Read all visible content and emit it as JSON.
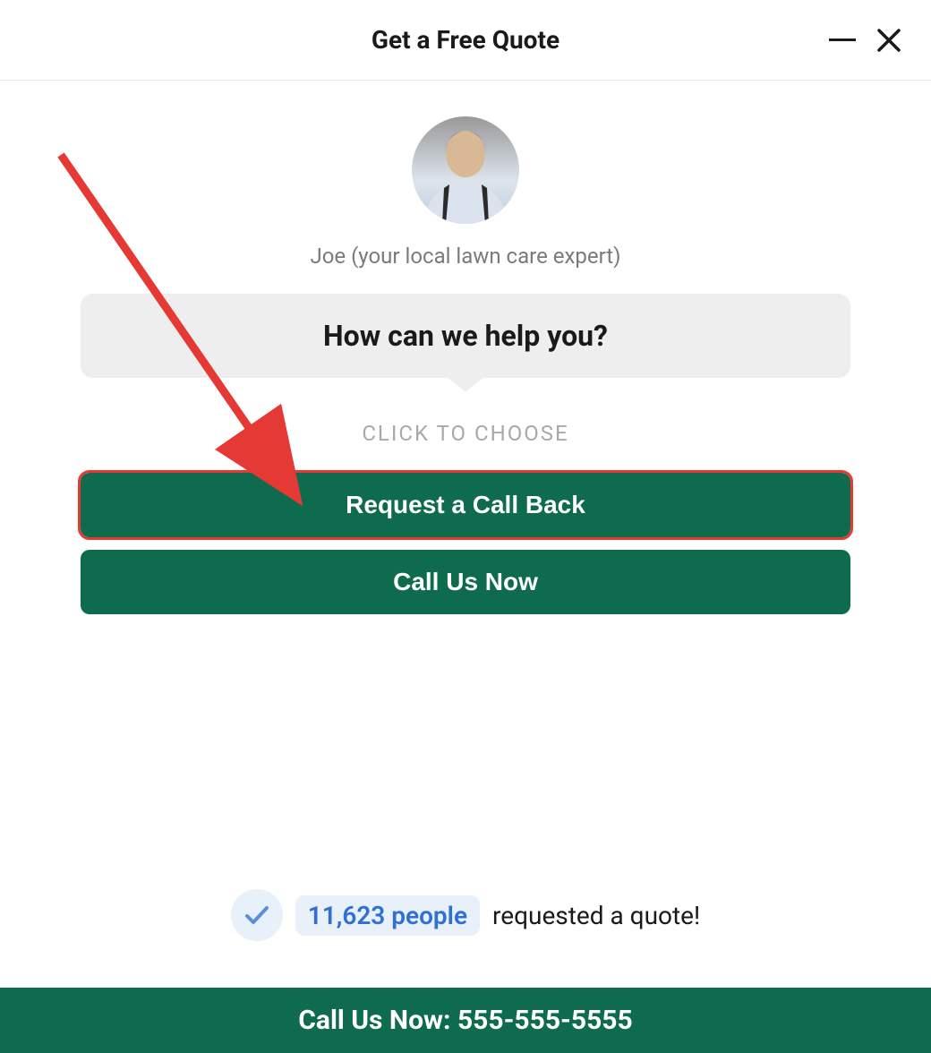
{
  "header": {
    "title": "Get a Free Quote"
  },
  "expert": {
    "label": "Joe (your local lawn care expert)"
  },
  "question": {
    "text": "How can we help you?"
  },
  "choose": {
    "label": "CLICK TO CHOOSE"
  },
  "options": {
    "request_callback": "Request a Call Back",
    "call_now": "Call Us Now"
  },
  "stats": {
    "people_count": "11,623 people",
    "suffix": "requested a quote!"
  },
  "footer": {
    "call_text": "Call Us Now: 555-555-5555"
  },
  "colors": {
    "primary": "#0f6b4e",
    "highlight": "#e53935",
    "accent": "#2f6fd6"
  }
}
